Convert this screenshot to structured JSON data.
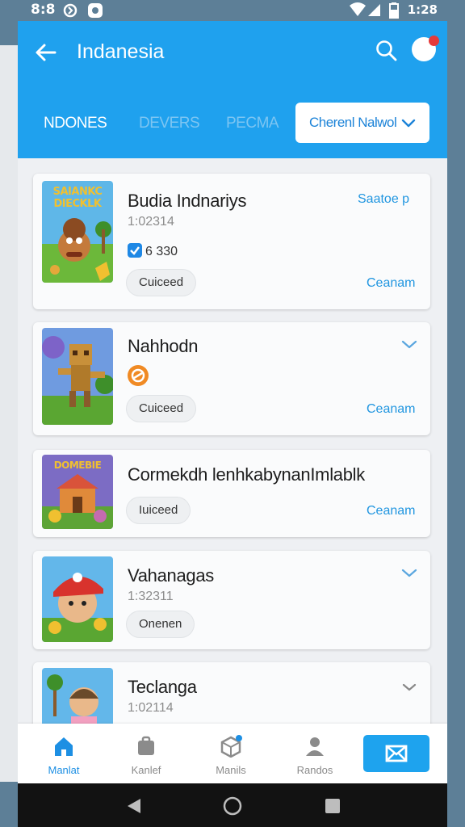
{
  "status_bar": {
    "time": "8:8",
    "clock_right": "1:28"
  },
  "header": {
    "title": "Indanesia"
  },
  "tabs": [
    {
      "label": "NDONES",
      "active": true
    },
    {
      "label": "DEVERS",
      "active": false
    },
    {
      "label": "PECMA",
      "active": false
    }
  ],
  "dropdown": {
    "label": "Cherenl Nalwol"
  },
  "cards": [
    {
      "title": "Budia Indnariys",
      "subtitle": "1:02314",
      "verified_text": "6 330",
      "chip": "Cuiceed",
      "action": "Ceanam",
      "top_right": "Saatoe p",
      "thumb_text": "SAIANKC DIECKLK"
    },
    {
      "title": "Nahhodn",
      "chip": "Cuiceed",
      "action": "Ceanam"
    },
    {
      "title": "Cormekdh lenhkabynanImlablk",
      "chip": "Iuiceed",
      "action": "Ceanam",
      "thumb_text": "DOMEBIE"
    },
    {
      "title": "Vahanagas",
      "subtitle": "1:32311",
      "chip": "Onenen"
    },
    {
      "title": "Teclanga",
      "subtitle": "1:02114"
    }
  ],
  "bottom_nav": [
    {
      "label": "Manlat",
      "icon": "home-icon",
      "active": true
    },
    {
      "label": "Kanlef",
      "icon": "bag-icon",
      "active": false
    },
    {
      "label": "Manils",
      "icon": "cube-icon",
      "active": false
    },
    {
      "label": "Randos",
      "icon": "person-icon",
      "active": false
    }
  ],
  "colors": {
    "accent": "#1fa1ee",
    "link": "#2196e0"
  }
}
